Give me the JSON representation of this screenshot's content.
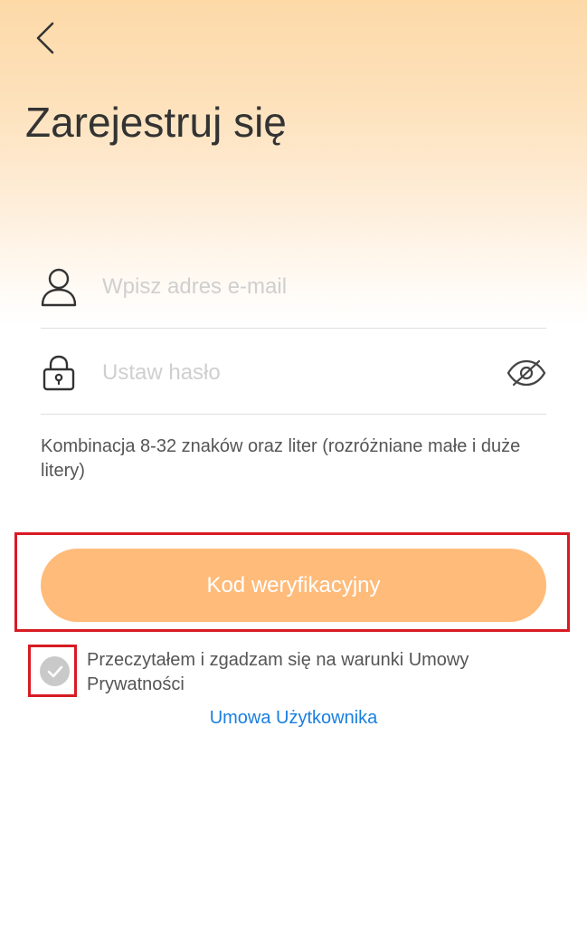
{
  "header": {
    "back_icon": "chevron-left-icon",
    "title": "Zarejestruj się"
  },
  "form": {
    "email": {
      "icon": "user-icon",
      "placeholder": "Wpisz adres e-mail",
      "value": ""
    },
    "password": {
      "icon": "lock-icon",
      "placeholder": "Ustaw hasło",
      "value": "",
      "toggle_icon": "eye-off-icon"
    },
    "password_hint": "Kombinacja 8-32 znaków oraz liter (rozróżniane małe i duże litery)"
  },
  "actions": {
    "verify_label": "Kod weryfikacyjny"
  },
  "agreement": {
    "checked": false,
    "text": "Przeczytałem i zgadzam się na warunki Umowy Prywatności",
    "user_agreement_link": "Umowa Użytkownika"
  },
  "colors": {
    "accent": "#ffbb7a",
    "link": "#1a7fe0",
    "highlight_frame": "#d81b23",
    "checkbox": "#c9c9c9"
  }
}
